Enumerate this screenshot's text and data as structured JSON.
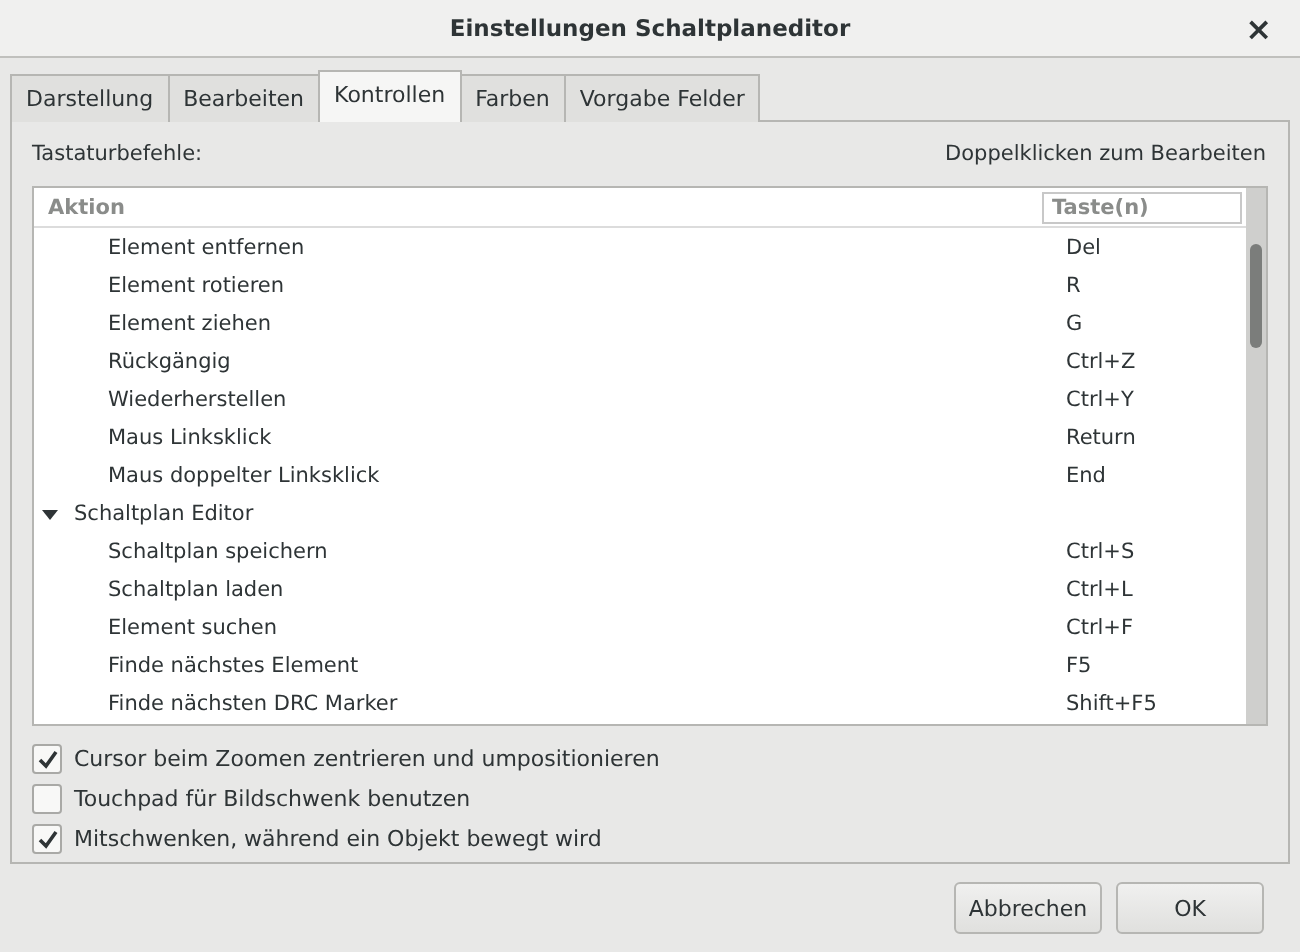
{
  "window": {
    "title": "Einstellungen Schaltplaneditor",
    "close": "×"
  },
  "tabs": [
    {
      "label": "Darstellung",
      "selected": false
    },
    {
      "label": "Bearbeiten",
      "selected": false
    },
    {
      "label": "Kontrollen",
      "selected": true
    },
    {
      "label": "Farben",
      "selected": false
    },
    {
      "label": "Vorgabe Felder",
      "selected": false
    }
  ],
  "hotkeys": {
    "label": "Tastaturbefehle:",
    "hint": "Doppelklicken zum Bearbeiten",
    "columns": [
      "Aktion",
      "Taste(n)"
    ],
    "tree": [
      {
        "children": [
          {
            "action": "Element entfernen",
            "key": "Del"
          },
          {
            "action": "Element rotieren",
            "key": "R"
          },
          {
            "action": "Element ziehen",
            "key": "G"
          },
          {
            "action": "Rückgängig",
            "key": "Ctrl+Z"
          },
          {
            "action": "Wiederherstellen",
            "key": "Ctrl+Y"
          },
          {
            "action": "Maus Linksklick",
            "key": "Return"
          },
          {
            "action": "Maus doppelter Linksklick",
            "key": "End"
          }
        ]
      },
      {
        "label": "Schaltplan Editor",
        "expanded": true,
        "children": [
          {
            "action": "Schaltplan speichern",
            "key": "Ctrl+S"
          },
          {
            "action": "Schaltplan laden",
            "key": "Ctrl+L"
          },
          {
            "action": "Element suchen",
            "key": "Ctrl+F"
          },
          {
            "action": "Finde nächstes Element",
            "key": "F5"
          },
          {
            "action": "Finde nächsten DRC Marker",
            "key": "Shift+F5"
          }
        ]
      }
    ]
  },
  "options": [
    {
      "label": "Cursor beim Zoomen zentrieren und umpositionieren",
      "checked": true
    },
    {
      "label": "Touchpad für Bildschwenk benutzen",
      "checked": false
    },
    {
      "label": "Mitschwenken, während ein Objekt bewegt wird",
      "checked": true
    }
  ],
  "buttons": [
    "Abbrechen",
    "OK"
  ]
}
